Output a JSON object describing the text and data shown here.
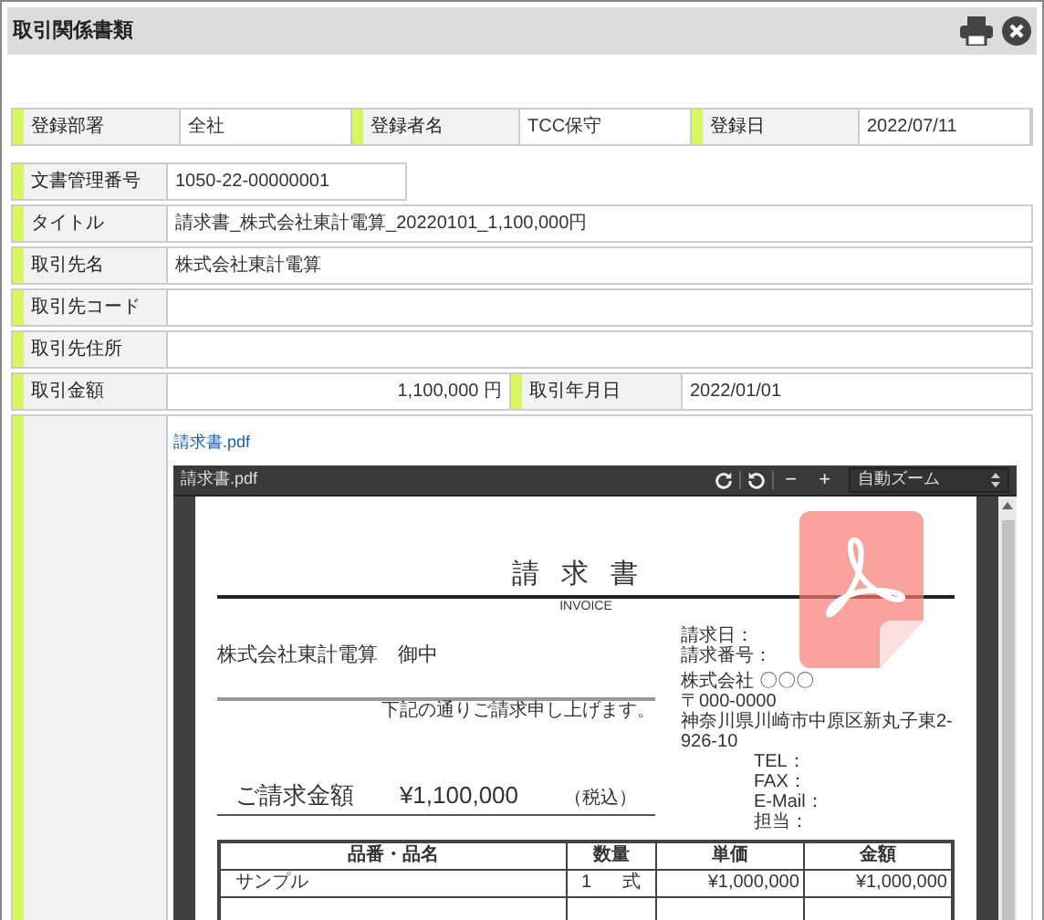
{
  "window": {
    "title": "取引関係書類"
  },
  "header_fields": [
    {
      "label": "登録部署",
      "value": "全社"
    },
    {
      "label": "登録者名",
      "value": "TCC保守"
    },
    {
      "label": "登録日",
      "value": "2022/07/11"
    }
  ],
  "rows": [
    {
      "kind": "short",
      "pairs": [
        {
          "label": "文書管理番号",
          "value": "1050-22-00000001",
          "kind": "text"
        }
      ]
    },
    {
      "kind": "full",
      "pairs": [
        {
          "label": "タイトル",
          "value": "請求書_株式会社東計電算_20220101_1,100,000円",
          "kind": "text"
        }
      ]
    },
    {
      "kind": "full",
      "pairs": [
        {
          "label": "取引先名",
          "value": "株式会社東計電算",
          "kind": "text"
        }
      ]
    },
    {
      "kind": "full",
      "pairs": [
        {
          "label": "取引先コード"
        }
      ]
    },
    {
      "kind": "full",
      "pairs": [
        {
          "label": "取引先住所"
        }
      ]
    },
    {
      "kind": "split",
      "pairs": [
        {
          "label": "取引金額",
          "value": "1,100,000 円",
          "kind": "amount"
        },
        {
          "label": "取引年月日",
          "value": "2022/01/01",
          "kind": "text"
        }
      ]
    }
  ],
  "attachment": {
    "link": "請求書.pdf",
    "viewer": {
      "filename": "請求書.pdf",
      "zoom_out": "−",
      "zoom_in": "+",
      "zoom": "自動ズーム",
      "document": {
        "title": "請求書",
        "subtitle": "INVOICE",
        "recipient": "株式会社東計電算　御中",
        "note": "下記の通りご請求申し上げます。",
        "issuer_lines": [
          "請求日：",
          "請求番号："
        ],
        "company_lines": [
          "株式会社 〇〇〇",
          "〒000-0000",
          "神奈川県川崎市中原区新丸子東2-926-10"
        ],
        "contact_lines": [
          "TEL：",
          "FAX：",
          "E-Mail：",
          "担当："
        ],
        "total_label": "ご請求金額",
        "total": "¥1,100,000",
        "tax_note": "（税込）",
        "table": {
          "columns": [
            "品番・品名",
            "数量",
            "単価",
            "金額"
          ],
          "rows": [
            {
              "name": "サンプル",
              "qty": "1",
              "unit": "式",
              "price": "¥1,000,000",
              "amount": "¥1,000,000"
            }
          ]
        }
      }
    }
  }
}
